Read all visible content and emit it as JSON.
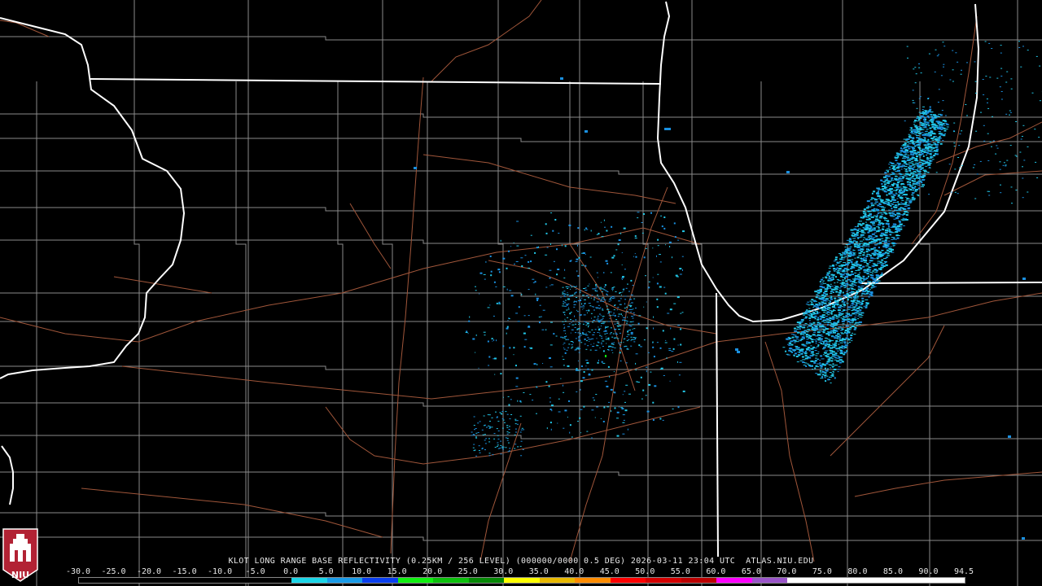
{
  "title": "KLOT LONG RANGE BASE REFLECTIVITY (0.25KM / 256 LEVEL) (000000/0000 0.5 DEG) 2026-03-11 23:04 UTC  ATLAS.NIU.EDU",
  "logo": {
    "text": "NIU",
    "color": "#b22234",
    "icon": "niu-castle-logo-icon"
  },
  "colorbar": {
    "tick_labels": [
      "-30.0",
      "-25.0",
      "-20.0",
      "-15.0",
      "-10.0",
      "-5.0",
      "0.0",
      "5.0",
      "10.0",
      "15.0",
      "20.0",
      "25.0",
      "30.0",
      "35.0",
      "40.0",
      "45.0",
      "50.0",
      "55.0",
      "60.0",
      "65.0",
      "70.0",
      "75.0",
      "80.0",
      "85.0",
      "90.0",
      "94.5"
    ],
    "colors": [
      "#000000",
      "#000000",
      "#000000",
      "#000000",
      "#000000",
      "#000000",
      "#1bd5e8",
      "#1a9be8",
      "#0a3ff0",
      "#10f010",
      "#0cc00c",
      "#068806",
      "#ffff00",
      "#e8b800",
      "#ff8c00",
      "#ff0000",
      "#d40000",
      "#bb0000",
      "#ff00ff",
      "#9a55c9",
      "#ffffff",
      "#ffffff",
      "#ffffff",
      "#ffffff",
      "#ffffff"
    ]
  },
  "colors": {
    "background": "#000000",
    "state_borders": "#ffffff",
    "county_lines": "#8a8a8a",
    "roads": "#a0563a",
    "echo_light": "#22c8e8",
    "echo_mid": "#1a90e0"
  }
}
